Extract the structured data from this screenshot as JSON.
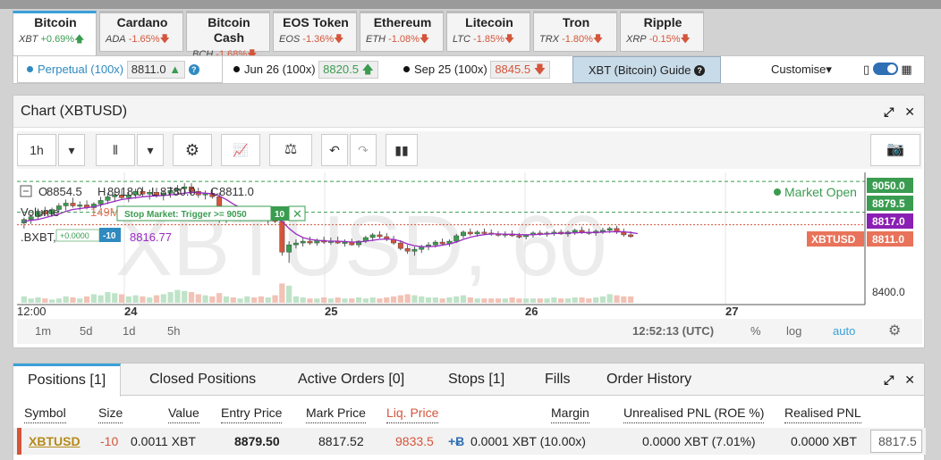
{
  "instruments": [
    {
      "name": "Bitcoin",
      "symbol": "XBT",
      "change": "+0.69%",
      "dir": "up",
      "active": true
    },
    {
      "name": "Cardano",
      "symbol": "ADA",
      "change": "-1.65%",
      "dir": "down"
    },
    {
      "name": "Bitcoin Cash",
      "symbol": "BCH",
      "change": "-1.68%",
      "dir": "down"
    },
    {
      "name": "EOS Token",
      "symbol": "EOS",
      "change": "-1.36%",
      "dir": "down"
    },
    {
      "name": "Ethereum",
      "symbol": "ETH",
      "change": "-1.08%",
      "dir": "down"
    },
    {
      "name": "Litecoin",
      "symbol": "LTC",
      "change": "-1.85%",
      "dir": "down"
    },
    {
      "name": "Tron",
      "symbol": "TRX",
      "change": "-1.80%",
      "dir": "down"
    },
    {
      "name": "Ripple",
      "symbol": "XRP",
      "change": "-0.15%",
      "dir": "down"
    }
  ],
  "contracts": {
    "perpetual": {
      "label": "Perpetual",
      "lev": "(100x)",
      "price": "8811.0"
    },
    "jun": {
      "label": "Jun 26",
      "lev": "(100x)",
      "price": "8820.5"
    },
    "sep": {
      "label": "Sep 25",
      "lev": "(100x)",
      "price": "8845.5"
    },
    "guide": "XBT (Bitcoin) Guide",
    "customise": "Customise"
  },
  "chart_panel": {
    "title": "Chart (XBTUSD)",
    "interval": "1h",
    "ohlc": {
      "o": "8854.5",
      "h": "8918.0",
      "l": "8780.0",
      "c": "8811.0"
    },
    "o_label": "O",
    "h_label": "H",
    "l_label": "L",
    "c_label": "C",
    "volume_label": "Volume",
    "volume_value": "149M",
    "volume_na": "n/a",
    "index_label": ".BXBT, BITMEX",
    "index_value": "8816.77",
    "watermark": "XBTUSD, 60",
    "market_status": "Market Open",
    "order_label": "Stop Market: Trigger >= 9050",
    "order_qty": "10",
    "pos_label": "+0.0000",
    "pos_qty": "-10",
    "price_tags": {
      "top": "9050.0",
      "second": "8879.5",
      "third": "8817.0",
      "last": "8811.0",
      "symbol": "XBTUSD"
    },
    "footer": {
      "ranges": [
        "1m",
        "5d",
        "1d",
        "5h"
      ],
      "time": "12:52:13 (UTC)",
      "pct": "%",
      "log": "log",
      "auto": "auto"
    }
  },
  "chart_data": {
    "type": "candlestick",
    "y_ticks": [
      "8400.0"
    ],
    "x_ticks": [
      "12:00",
      "24",
      "25",
      "26",
      "27"
    ],
    "candles": [
      {
        "o": 8820,
        "h": 8850,
        "l": 8790,
        "c": 8840,
        "v": 0.3
      },
      {
        "o": 8840,
        "h": 8870,
        "l": 8815,
        "c": 8855,
        "v": 0.2
      },
      {
        "o": 8855,
        "h": 8900,
        "l": 8840,
        "c": 8885,
        "v": 0.25
      },
      {
        "o": 8885,
        "h": 8910,
        "l": 8860,
        "c": 8870,
        "v": 0.2
      },
      {
        "o": 8870,
        "h": 8905,
        "l": 8855,
        "c": 8895,
        "v": 0.15
      },
      {
        "o": 8895,
        "h": 8930,
        "l": 8880,
        "c": 8915,
        "v": 0.2
      },
      {
        "o": 8915,
        "h": 8950,
        "l": 8890,
        "c": 8930,
        "v": 0.3
      },
      {
        "o": 8930,
        "h": 8960,
        "l": 8905,
        "c": 8915,
        "v": 0.25
      },
      {
        "o": 8915,
        "h": 8940,
        "l": 8890,
        "c": 8920,
        "v": 0.2
      },
      {
        "o": 8920,
        "h": 8945,
        "l": 8895,
        "c": 8905,
        "v": 0.3
      },
      {
        "o": 8905,
        "h": 8935,
        "l": 8880,
        "c": 8925,
        "v": 0.4
      },
      {
        "o": 8925,
        "h": 8965,
        "l": 8905,
        "c": 8945,
        "v": 0.35
      },
      {
        "o": 8945,
        "h": 8985,
        "l": 8925,
        "c": 8965,
        "v": 0.5
      },
      {
        "o": 8965,
        "h": 8995,
        "l": 8940,
        "c": 8975,
        "v": 0.45
      },
      {
        "o": 8975,
        "h": 9005,
        "l": 8950,
        "c": 8960,
        "v": 0.4
      },
      {
        "o": 8960,
        "h": 8990,
        "l": 8935,
        "c": 8975,
        "v": 0.3
      },
      {
        "o": 8975,
        "h": 9010,
        "l": 8955,
        "c": 8995,
        "v": 0.35
      },
      {
        "o": 8995,
        "h": 9020,
        "l": 8965,
        "c": 8980,
        "v": 0.3
      },
      {
        "o": 8980,
        "h": 9005,
        "l": 8950,
        "c": 8990,
        "v": 0.25
      },
      {
        "o": 8990,
        "h": 9015,
        "l": 8960,
        "c": 8975,
        "v": 0.35
      },
      {
        "o": 8975,
        "h": 9000,
        "l": 8945,
        "c": 8985,
        "v": 0.4
      },
      {
        "o": 8985,
        "h": 9020,
        "l": 8960,
        "c": 9000,
        "v": 0.5
      },
      {
        "o": 9000,
        "h": 9030,
        "l": 8975,
        "c": 9010,
        "v": 0.6
      },
      {
        "o": 9010,
        "h": 9040,
        "l": 8985,
        "c": 9020,
        "v": 0.55
      },
      {
        "o": 9020,
        "h": 9040,
        "l": 8980,
        "c": 8995,
        "v": 0.5
      },
      {
        "o": 8995,
        "h": 9015,
        "l": 8960,
        "c": 8975,
        "v": 0.4
      },
      {
        "o": 8975,
        "h": 9000,
        "l": 8950,
        "c": 8985,
        "v": 0.35
      },
      {
        "o": 8985,
        "h": 9010,
        "l": 8955,
        "c": 8965,
        "v": 0.3
      },
      {
        "o": 8965,
        "h": 8985,
        "l": 8820,
        "c": 8845,
        "v": 0.45
      },
      {
        "o": 8845,
        "h": 8880,
        "l": 8820,
        "c": 8860,
        "v": 0.3
      },
      {
        "o": 8860,
        "h": 8890,
        "l": 8835,
        "c": 8845,
        "v": 0.25
      },
      {
        "o": 8845,
        "h": 8875,
        "l": 8830,
        "c": 8870,
        "v": 0.2
      },
      {
        "o": 8870,
        "h": 8900,
        "l": 8850,
        "c": 8875,
        "v": 0.3
      },
      {
        "o": 8875,
        "h": 8900,
        "l": 8845,
        "c": 8855,
        "v": 0.25
      },
      {
        "o": 8855,
        "h": 8880,
        "l": 8830,
        "c": 8840,
        "v": 0.3
      },
      {
        "o": 8840,
        "h": 8870,
        "l": 8815,
        "c": 8860,
        "v": 0.25
      },
      {
        "o": 8860,
        "h": 8880,
        "l": 8820,
        "c": 8830,
        "v": 0.35
      },
      {
        "o": 8830,
        "h": 8840,
        "l": 8640,
        "c": 8660,
        "v": 0.9
      },
      {
        "o": 8660,
        "h": 8720,
        "l": 8600,
        "c": 8700,
        "v": 0.8
      },
      {
        "o": 8700,
        "h": 8730,
        "l": 8680,
        "c": 8710,
        "v": 0.3
      },
      {
        "o": 8710,
        "h": 8740,
        "l": 8690,
        "c": 8720,
        "v": 0.25
      },
      {
        "o": 8720,
        "h": 8745,
        "l": 8700,
        "c": 8710,
        "v": 0.2
      },
      {
        "o": 8710,
        "h": 8735,
        "l": 8695,
        "c": 8725,
        "v": 0.2
      },
      {
        "o": 8725,
        "h": 8745,
        "l": 8705,
        "c": 8715,
        "v": 0.25
      },
      {
        "o": 8715,
        "h": 8740,
        "l": 8700,
        "c": 8720,
        "v": 0.2
      },
      {
        "o": 8720,
        "h": 8745,
        "l": 8705,
        "c": 8710,
        "v": 0.25
      },
      {
        "o": 8710,
        "h": 8730,
        "l": 8690,
        "c": 8715,
        "v": 0.2
      },
      {
        "o": 8715,
        "h": 8735,
        "l": 8695,
        "c": 8700,
        "v": 0.2
      },
      {
        "o": 8700,
        "h": 8725,
        "l": 8685,
        "c": 8720,
        "v": 0.25
      },
      {
        "o": 8720,
        "h": 8750,
        "l": 8710,
        "c": 8740,
        "v": 0.2
      },
      {
        "o": 8740,
        "h": 8765,
        "l": 8720,
        "c": 8755,
        "v": 0.25
      },
      {
        "o": 8755,
        "h": 8775,
        "l": 8735,
        "c": 8745,
        "v": 0.2
      },
      {
        "o": 8745,
        "h": 8765,
        "l": 8720,
        "c": 8730,
        "v": 0.25
      },
      {
        "o": 8730,
        "h": 8750,
        "l": 8700,
        "c": 8710,
        "v": 0.3
      },
      {
        "o": 8710,
        "h": 8725,
        "l": 8670,
        "c": 8680,
        "v": 0.35
      },
      {
        "o": 8680,
        "h": 8700,
        "l": 8650,
        "c": 8665,
        "v": 0.4
      },
      {
        "o": 8665,
        "h": 8690,
        "l": 8640,
        "c": 8675,
        "v": 0.35
      },
      {
        "o": 8675,
        "h": 8700,
        "l": 8655,
        "c": 8690,
        "v": 0.3
      },
      {
        "o": 8690,
        "h": 8715,
        "l": 8670,
        "c": 8700,
        "v": 0.25
      },
      {
        "o": 8700,
        "h": 8725,
        "l": 8685,
        "c": 8715,
        "v": 0.25
      },
      {
        "o": 8715,
        "h": 8735,
        "l": 8700,
        "c": 8705,
        "v": 0.2
      },
      {
        "o": 8705,
        "h": 8730,
        "l": 8690,
        "c": 8720,
        "v": 0.25
      },
      {
        "o": 8720,
        "h": 8760,
        "l": 8710,
        "c": 8750,
        "v": 0.3
      },
      {
        "o": 8750,
        "h": 8780,
        "l": 8735,
        "c": 8770,
        "v": 0.35
      },
      {
        "o": 8770,
        "h": 8790,
        "l": 8750,
        "c": 8760,
        "v": 0.25
      },
      {
        "o": 8760,
        "h": 8780,
        "l": 8745,
        "c": 8770,
        "v": 0.2
      },
      {
        "o": 8770,
        "h": 8790,
        "l": 8755,
        "c": 8765,
        "v": 0.2
      },
      {
        "o": 8765,
        "h": 8785,
        "l": 8750,
        "c": 8760,
        "v": 0.2
      },
      {
        "o": 8760,
        "h": 8775,
        "l": 8745,
        "c": 8755,
        "v": 0.2
      },
      {
        "o": 8755,
        "h": 8775,
        "l": 8740,
        "c": 8760,
        "v": 0.2
      },
      {
        "o": 8760,
        "h": 8780,
        "l": 8745,
        "c": 8750,
        "v": 0.25
      },
      {
        "o": 8750,
        "h": 8765,
        "l": 8735,
        "c": 8745,
        "v": 0.2
      },
      {
        "o": 8745,
        "h": 8760,
        "l": 8730,
        "c": 8755,
        "v": 0.2
      },
      {
        "o": 8755,
        "h": 8775,
        "l": 8740,
        "c": 8765,
        "v": 0.2
      },
      {
        "o": 8765,
        "h": 8780,
        "l": 8750,
        "c": 8760,
        "v": 0.2
      },
      {
        "o": 8760,
        "h": 8775,
        "l": 8745,
        "c": 8765,
        "v": 0.2
      },
      {
        "o": 8765,
        "h": 8785,
        "l": 8750,
        "c": 8770,
        "v": 0.25
      },
      {
        "o": 8770,
        "h": 8785,
        "l": 8755,
        "c": 8760,
        "v": 0.2
      },
      {
        "o": 8760,
        "h": 8780,
        "l": 8745,
        "c": 8770,
        "v": 0.2
      },
      {
        "o": 8770,
        "h": 8790,
        "l": 8755,
        "c": 8780,
        "v": 0.25
      },
      {
        "o": 8780,
        "h": 8800,
        "l": 8760,
        "c": 8770,
        "v": 0.25
      },
      {
        "o": 8770,
        "h": 8790,
        "l": 8755,
        "c": 8765,
        "v": 0.2
      },
      {
        "o": 8765,
        "h": 8785,
        "l": 8750,
        "c": 8775,
        "v": 0.25
      },
      {
        "o": 8775,
        "h": 8795,
        "l": 8760,
        "c": 8780,
        "v": 0.3
      },
      {
        "o": 8780,
        "h": 8800,
        "l": 8765,
        "c": 8790,
        "v": 0.4
      },
      {
        "o": 8790,
        "h": 8805,
        "l": 8760,
        "c": 8770,
        "v": 0.35
      },
      {
        "o": 8770,
        "h": 8790,
        "l": 8745,
        "c": 8755,
        "v": 0.3
      },
      {
        "o": 8755,
        "h": 8775,
        "l": 8740,
        "c": 8745,
        "v": 0.3
      }
    ],
    "ma": [
      8830,
      8835,
      8840,
      8850,
      8860,
      8870,
      8885,
      8895,
      8900,
      8905,
      8910,
      8920,
      8930,
      8940,
      8950,
      8955,
      8960,
      8965,
      8968,
      8970,
      8972,
      8976,
      8980,
      8985,
      8990,
      8988,
      8985,
      8982,
      8970,
      8950,
      8925,
      8905,
      8890,
      8880,
      8870,
      8860,
      8855,
      8830,
      8790,
      8760,
      8740,
      8730,
      8725,
      8722,
      8720,
      8720,
      8718,
      8715,
      8715,
      8720,
      8725,
      8730,
      8732,
      8730,
      8720,
      8705,
      8695,
      8690,
      8690,
      8692,
      8698,
      8705,
      8715,
      8730,
      8742,
      8750,
      8756,
      8760,
      8760,
      8758,
      8758,
      8756,
      8755,
      8756,
      8758,
      8760,
      8762,
      8764,
      8765,
      8766,
      8768,
      8768,
      8768,
      8770,
      8772,
      8773,
      8772,
      8768,
      8762
    ],
    "y_min": 8380,
    "y_max": 9080,
    "levels": {
      "order": 9050,
      "entry": 8879.5,
      "index": 8817,
      "last": 8811
    }
  },
  "positions": {
    "tabs": [
      "Positions [1]",
      "Closed Positions",
      "Active Orders [0]",
      "Stops [1]",
      "Fills",
      "Order History"
    ],
    "headers": [
      "Symbol",
      "Size",
      "Value",
      "Entry Price",
      "Mark Price",
      "Liq. Price",
      "Margin",
      "Unrealised PNL (ROE %)",
      "Realised PNL"
    ],
    "row": {
      "symbol": "XBTUSD",
      "size": "-10",
      "value": "0.0011 XBT",
      "entry": "8879.50",
      "mark": "8817.52",
      "liq": "9833.5",
      "margin_icon": "+Ƀ",
      "margin": "0.0001 XBT (10.00x)",
      "upnl": "0.0000 XBT (7.01%)",
      "rpnl": "0.0000 XBT",
      "close": "8817.5"
    }
  },
  "colors": {
    "up": "#3a9c50",
    "down": "#d4553a",
    "accent": "#3aa0d8",
    "ma": "#9b2bc4"
  }
}
